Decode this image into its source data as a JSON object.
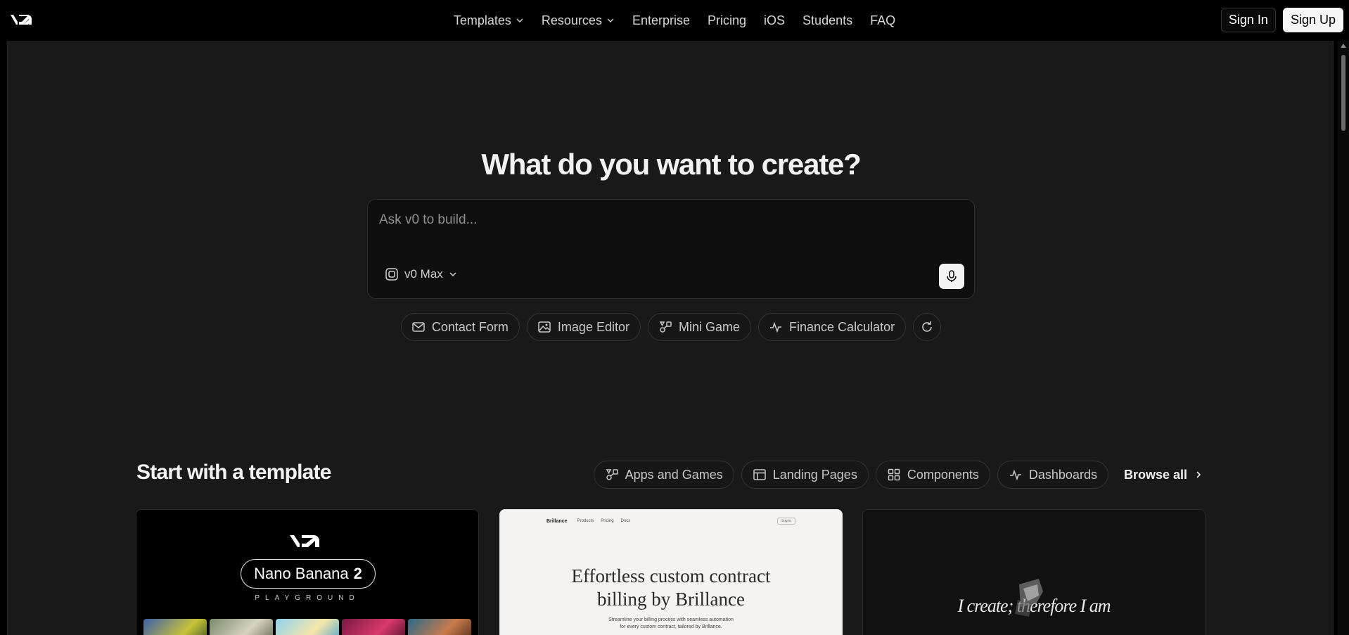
{
  "nav": {
    "logo": "v0",
    "links": [
      {
        "label": "Templates",
        "has_menu": true
      },
      {
        "label": "Resources",
        "has_menu": true
      },
      {
        "label": "Enterprise",
        "has_menu": false
      },
      {
        "label": "Pricing",
        "has_menu": false
      },
      {
        "label": "iOS",
        "has_menu": false
      },
      {
        "label": "Students",
        "has_menu": false
      },
      {
        "label": "FAQ",
        "has_menu": false
      }
    ],
    "sign_in": "Sign In",
    "sign_up": "Sign Up"
  },
  "hero": {
    "title": "What do you want to create?",
    "prompt_placeholder": "Ask v0 to build...",
    "model": "v0 Max",
    "model_icon": "cube-icon",
    "mic_icon": "microphone-icon"
  },
  "suggestions": [
    {
      "label": "Contact Form",
      "icon": "mail-icon"
    },
    {
      "label": "Image Editor",
      "icon": "image-icon"
    },
    {
      "label": "Mini Game",
      "icon": "shapes-icon"
    },
    {
      "label": "Finance Calculator",
      "icon": "activity-icon"
    }
  ],
  "templates_section": {
    "title": "Start with a template",
    "filters": [
      {
        "label": "Apps and Games",
        "icon": "shapes-icon"
      },
      {
        "label": "Landing Pages",
        "icon": "layout-icon"
      },
      {
        "label": "Components",
        "icon": "grid-icon"
      },
      {
        "label": "Dashboards",
        "icon": "activity-icon"
      }
    ],
    "browse_all": "Browse all"
  },
  "cards": {
    "card1": {
      "logo": "v0",
      "pill_text": "Nano Banana",
      "pill_number": "2",
      "subtitle": "PLAYGROUND"
    },
    "card2": {
      "brand": "Brillance",
      "nav_items": [
        "Products",
        "Pricing",
        "Docs"
      ],
      "login": "Log in",
      "headline_line1": "Effortless custom contract",
      "headline_line2": "billing by Brillance",
      "sub_line1": "Streamline your billing process with seamless automation",
      "sub_line2": "for every custom contract, tailored by Brillance."
    },
    "card3": {
      "text": "I create; therefore I am"
    }
  }
}
